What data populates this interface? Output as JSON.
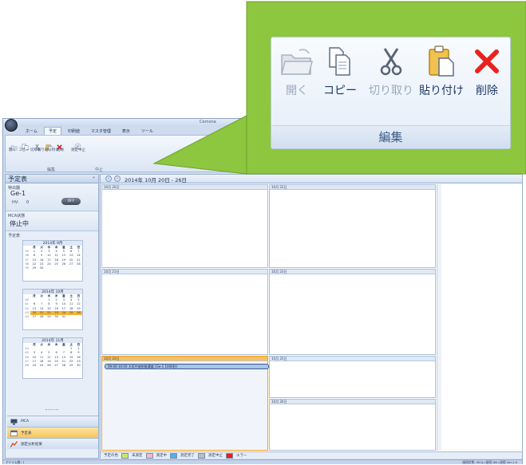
{
  "app": {
    "title": "Cemona",
    "ribbon_tabs": [
      "ホーム",
      "予定",
      "印刷値",
      "マスタ管理",
      "表示",
      "ツール"
    ],
    "active_tab_index": 1,
    "ribbon_small_buttons": [
      "開く",
      "コピー",
      "切り取り",
      "貼り付け",
      "削除",
      "測定中止"
    ],
    "ribbon_groups": [
      "編集",
      "中止"
    ]
  },
  "sidebar": {
    "title": "予定表",
    "collapse_glyph": "«",
    "device_label": "特出器",
    "device_name": "Ge-1",
    "hv_label": "HV:",
    "hv_value": "0",
    "toggle_label": "OFF",
    "mca_status_label": "MCA状態",
    "mca_status_value": "停止中",
    "schedule_label": "予定表",
    "calendars": [
      {
        "title": "2014年 9月",
        "weeks": [
          [
            "35",
            "1",
            "2",
            "3",
            "4",
            "5",
            "6",
            "7"
          ],
          [
            "36",
            "8",
            "9",
            "10",
            "11",
            "12",
            "13",
            "14"
          ],
          [
            "37",
            "15",
            "16",
            "17",
            "18",
            "19",
            "20",
            "21"
          ],
          [
            "38",
            "22",
            "23",
            "24",
            "25",
            "26",
            "27",
            "28"
          ],
          [
            "39",
            "29",
            "30",
            "",
            "",
            "",
            "",
            ""
          ]
        ]
      },
      {
        "title": "2014年 10月",
        "weeks": [
          [
            "40",
            "",
            "",
            "1",
            "2",
            "3",
            "4",
            "5"
          ],
          [
            "41",
            "6",
            "7",
            "8",
            "9",
            "10",
            "11",
            "12"
          ],
          [
            "42",
            "13",
            "14",
            "15",
            "16",
            "17",
            "18",
            "19"
          ],
          [
            "43",
            "20",
            "21",
            "22",
            "23",
            "24",
            "25",
            "26"
          ],
          [
            "44",
            "27",
            "28",
            "29",
            "30",
            "31",
            "",
            ""
          ]
        ],
        "highlight_week_index": 3
      },
      {
        "title": "2014年 11月",
        "weeks": [
          [
            "44",
            "",
            "",
            "",
            "",
            "",
            "1",
            "2"
          ],
          [
            "45",
            "3",
            "4",
            "5",
            "6",
            "7",
            "8",
            "9"
          ],
          [
            "46",
            "10",
            "11",
            "12",
            "13",
            "14",
            "15",
            "16"
          ],
          [
            "47",
            "17",
            "18",
            "19",
            "20",
            "21",
            "22",
            "23"
          ],
          [
            "48",
            "24",
            "25",
            "26",
            "27",
            "28",
            "29",
            "30"
          ]
        ]
      }
    ],
    "weekday_headers": [
      "",
      "月",
      "火",
      "水",
      "木",
      "金",
      "土",
      "日"
    ],
    "nav_items": [
      {
        "label": "MCA",
        "selected": false
      },
      {
        "label": "予定表",
        "selected": true
      },
      {
        "label": "測定分析結果",
        "selected": false
      }
    ]
  },
  "calendar": {
    "range_label": "2014年 10月 20日 - 26日",
    "days": [
      "10月 20日",
      "10月 21日",
      "10月 22日",
      "10月 23日",
      "10月 24日",
      "10月 25日",
      "10月 26日"
    ],
    "today_index": 4,
    "event_text": "09:00-10:00 大気中放射能濃度 (Ge-1 1000秒)",
    "legend_label": "予定の色",
    "legend": [
      {
        "label": "未測定",
        "color": "#c8e86a"
      },
      {
        "label": "測定中",
        "color": "#f6b7c6"
      },
      {
        "label": "測定完了",
        "color": "#4fb0e6"
      },
      {
        "label": "測定中止",
        "color": "#b8bcc4"
      },
      {
        "label": "エラー",
        "color": "#e02020"
      }
    ]
  },
  "status": {
    "left": "アイテム数: 1",
    "right": "接続状態: MCA=接続  DB=接続  Ver.1.0"
  },
  "callout": {
    "buttons": [
      {
        "label": "開く",
        "enabled": false,
        "icon": "open-folder-icon"
      },
      {
        "label": "コピー",
        "enabled": true,
        "icon": "copy-icon"
      },
      {
        "label": "切り取り",
        "enabled": false,
        "icon": "scissors-icon"
      },
      {
        "label": "貼り付け",
        "enabled": true,
        "icon": "paste-icon"
      },
      {
        "label": "削除",
        "enabled": true,
        "icon": "delete-x-icon"
      }
    ],
    "group_label": "編集",
    "background_color": "#8dc63f"
  }
}
